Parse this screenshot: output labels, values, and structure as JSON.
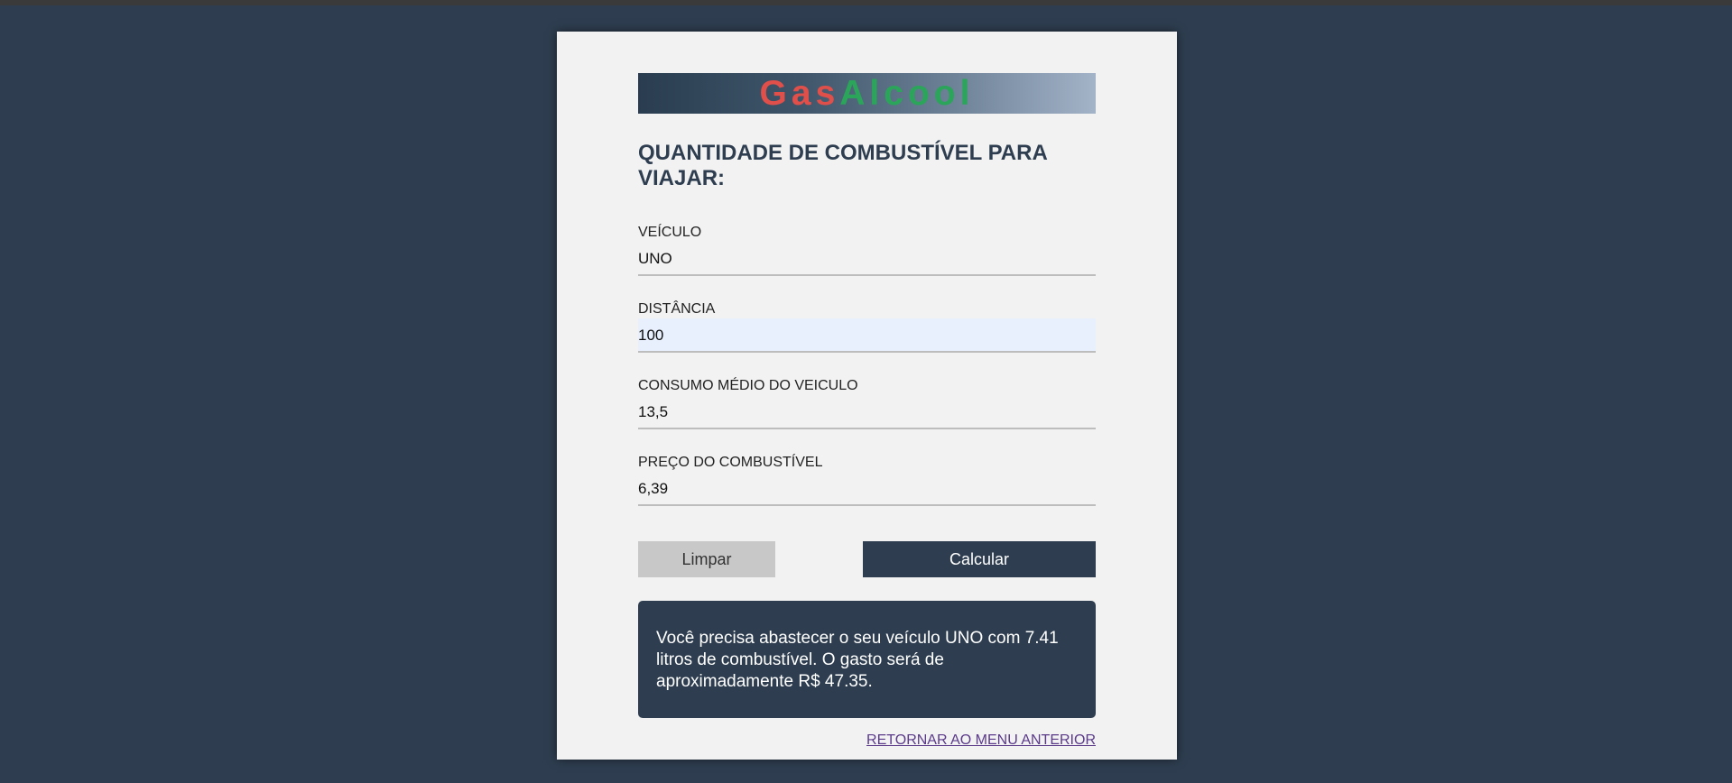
{
  "logo": {
    "part1": "Gas",
    "part2": "Alcool"
  },
  "title": "QUANTIDADE DE COMBUSTÍVEL PARA VIAJAR:",
  "fields": {
    "vehicle": {
      "label": "VEÍCULO",
      "value": "UNO"
    },
    "distance": {
      "label": "DISTÂNCIA",
      "value": "100"
    },
    "consumption": {
      "label": "CONSUMO MÉDIO DO VEICULO",
      "value": "13,5"
    },
    "price": {
      "label": "PREÇO DO COMBUSTÍVEL",
      "value": "6,39"
    }
  },
  "buttons": {
    "clear": "Limpar",
    "calculate": "Calcular"
  },
  "result": "Você precisa abastecer o seu veículo UNO com 7.41 litros de combustível. O gasto será de aproximadamente R$ 47.35.",
  "back_link": "RETORNAR AO MENU ANTERIOR",
  "colors": {
    "background": "#2e3e50",
    "card": "#f2f2f2",
    "logo_gas": "#e14f4a",
    "logo_alcool": "#2ba55a",
    "button_primary": "#2e3e50",
    "button_secondary": "#c8c8c8",
    "link": "#5b3a8a"
  }
}
